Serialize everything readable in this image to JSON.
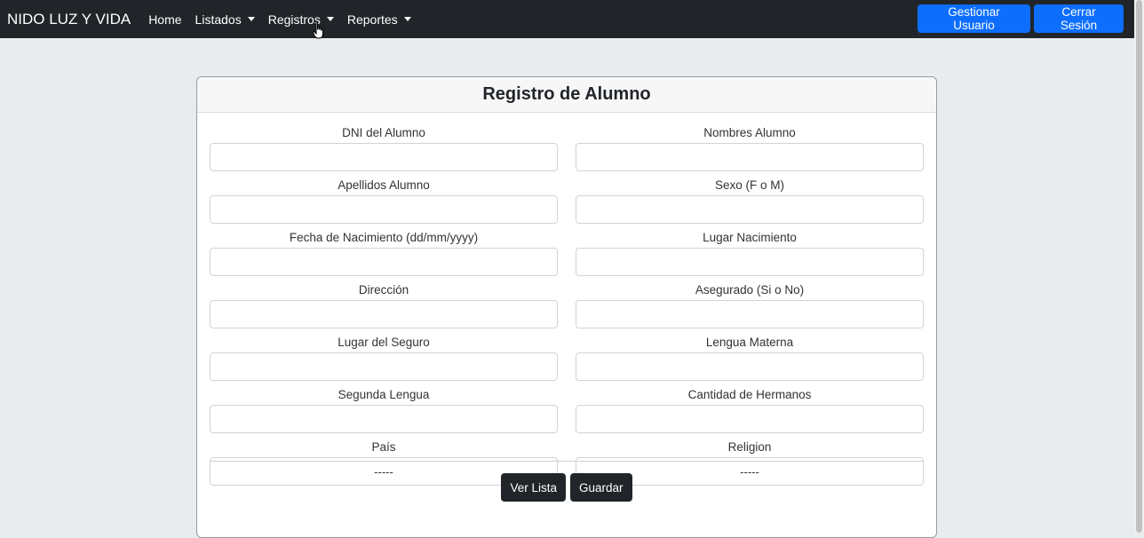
{
  "navbar": {
    "brand": "NIDO LUZ Y VIDA",
    "links": [
      {
        "label": "Home",
        "dropdown": false
      },
      {
        "label": "Listados",
        "dropdown": true
      },
      {
        "label": "Registros",
        "dropdown": true
      },
      {
        "label": "Reportes",
        "dropdown": true
      }
    ],
    "buttons": {
      "gestionar": "Gestionar Usuario",
      "cerrar": "Cerrar Sesión"
    }
  },
  "form": {
    "title": "Registro de Alumno",
    "fields": {
      "dni": {
        "label": "DNI del Alumno",
        "value": ""
      },
      "nombres": {
        "label": "Nombres Alumno",
        "value": ""
      },
      "apellidos": {
        "label": "Apellidos Alumno",
        "value": ""
      },
      "sexo": {
        "label": "Sexo (F o M)",
        "value": ""
      },
      "fecha_nac": {
        "label": "Fecha de Nacimiento (dd/mm/yyyy)",
        "value": ""
      },
      "lugar_nac": {
        "label": "Lugar Nacimiento",
        "value": ""
      },
      "direccion": {
        "label": "Dirección",
        "value": ""
      },
      "asegurado": {
        "label": "Asegurado (Si o No)",
        "value": ""
      },
      "lugar_seguro": {
        "label": "Lugar del Seguro",
        "value": ""
      },
      "lengua_materna": {
        "label": "Lengua Materna",
        "value": ""
      },
      "segunda_lengua": {
        "label": "Segunda Lengua",
        "value": ""
      },
      "cantidad_hermanos": {
        "label": "Cantidad de Hermanos",
        "value": ""
      },
      "pais": {
        "label": "País",
        "selected": "-----"
      },
      "religion": {
        "label": "Religion",
        "selected": "-----"
      }
    },
    "buttons": {
      "ver_lista": "Ver Lista",
      "guardar": "Guardar"
    }
  },
  "colors": {
    "navbar_bg": "#212529",
    "primary": "#0d6efd",
    "dark_button": "#212529",
    "page_bg": "#e9ecef"
  },
  "icons": {
    "cursor": "hand-pointer-icon",
    "dropdown": "caret-down-icon"
  }
}
